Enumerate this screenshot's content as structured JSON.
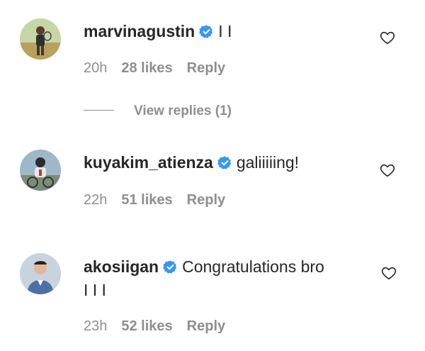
{
  "comments": [
    {
      "username": "marvinagustin",
      "text": "I I",
      "text_line2": "",
      "time": "20h",
      "likes": "28 likes",
      "reply": "Reply",
      "view_replies": "View replies (1)"
    },
    {
      "username": "kuyakim_atienza",
      "text": "galiiiiing!",
      "text_line2": "",
      "time": "22h",
      "likes": "51 likes",
      "reply": "Reply"
    },
    {
      "username": "akosiigan",
      "text": "Congratulations bro",
      "text_line2": "I I I",
      "time": "23h",
      "likes": "52 likes",
      "reply": "Reply"
    }
  ],
  "colors": {
    "verified_blue": "#3897f0",
    "text": "#262626",
    "meta_gray": "#8e8e8e"
  },
  "icons": {
    "verified": "verified-badge-icon",
    "like": "heart-outline-icon"
  }
}
